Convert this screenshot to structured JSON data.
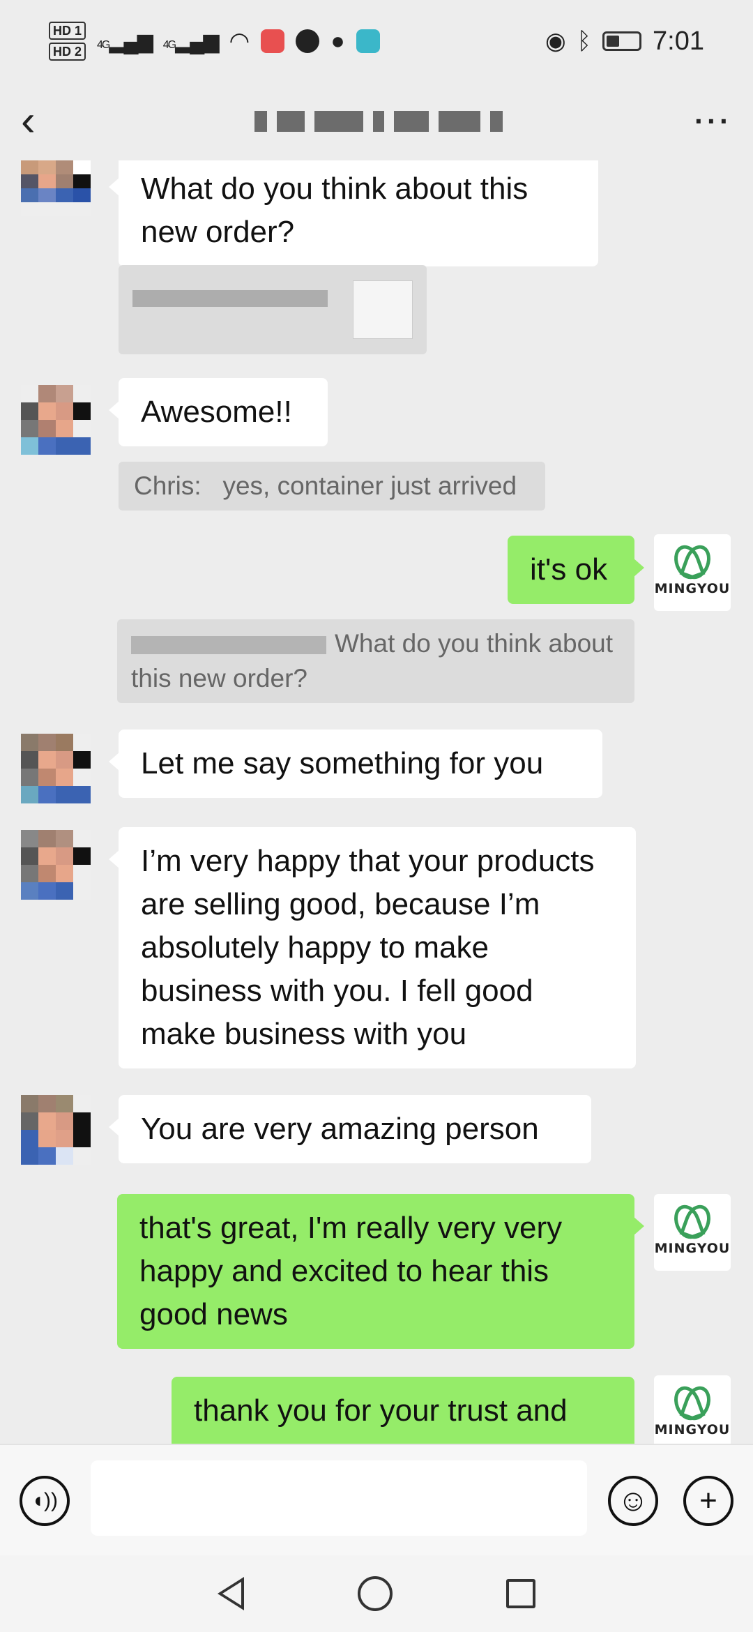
{
  "status_bar": {
    "hd1": "HD 1",
    "hd2": "HD 2",
    "net1": "4G",
    "net2": "4G",
    "time": "7:01"
  },
  "header": {
    "back_icon": "chevron-left-icon",
    "more_icon": "more-dots-icon"
  },
  "messages": [
    {
      "side": "theirs",
      "text": "What do you think about this new order?"
    },
    {
      "side": "theirs",
      "text": "Awesome!!"
    },
    {
      "quote_author": "Chris:",
      "quote_text": "yes, container just arrived"
    },
    {
      "side": "mine",
      "text": "it's ok"
    },
    {
      "quote_text": "What do you think about this new order?"
    },
    {
      "side": "theirs",
      "text": "Let me say something for you"
    },
    {
      "side": "theirs",
      "text": "I’m very happy that your products are selling good, because I’m absolutely happy to make business with you. I fell good make business with you"
    },
    {
      "side": "theirs",
      "text": "You are very amazing person"
    },
    {
      "side": "mine",
      "text": "that's great, I'm really very very happy and excited to hear this good news"
    },
    {
      "side": "mine",
      "text": "thank you for your trust and"
    }
  ],
  "logo": {
    "brand": "MINGYOU",
    "color": "#3aa05a"
  },
  "composer": {
    "voice_icon": "voice-icon",
    "emoji_icon": "emoji-icon",
    "plus_icon": "plus-icon",
    "input_value": ""
  },
  "colors": {
    "mine_bubble": "#95ec69",
    "theirs_bubble": "#ffffff",
    "background": "#ededed"
  }
}
